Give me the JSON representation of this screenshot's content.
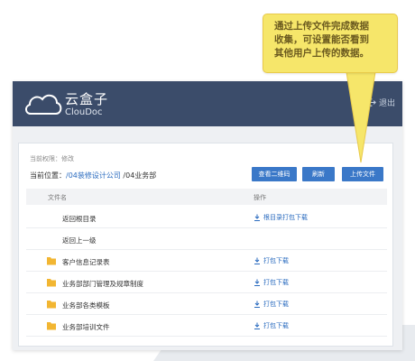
{
  "header": {
    "logo_cn": "云盒子",
    "logo_en": "ClouDoc",
    "logout_label": "退出"
  },
  "panel": {
    "permission": "当前权限：修改",
    "location_prefix": "当前位置：",
    "breadcrumb": [
      "/04装修设计公司",
      "/04业务部"
    ],
    "buttons": {
      "qrcode": "查看二维码",
      "refresh": "刷新",
      "upload": "上传文件"
    },
    "table": {
      "col_name": "文件名",
      "col_action": "操作",
      "rows": [
        {
          "name": "返回根目录",
          "action": "根目录打包下载",
          "folder": false
        },
        {
          "name": "返回上一级",
          "action": "",
          "folder": false
        },
        {
          "name": "客户信息记录表",
          "action": "打包下载",
          "folder": true
        },
        {
          "name": "业务部部门管理及规章制度",
          "action": "打包下载",
          "folder": true
        },
        {
          "name": "业务部各类模板",
          "action": "打包下载",
          "folder": true
        },
        {
          "name": "业务部培训文件",
          "action": "打包下载",
          "folder": true
        }
      ]
    }
  },
  "callout": {
    "lines": [
      "通过上传文件完成数据",
      "收集，可设置能否看到",
      "其他用户上传的数据。"
    ]
  },
  "colors": {
    "topbar": "#3b4c6a",
    "accent": "#3a78c8",
    "callout": "#f6e66a",
    "folder": "#f2b632"
  }
}
